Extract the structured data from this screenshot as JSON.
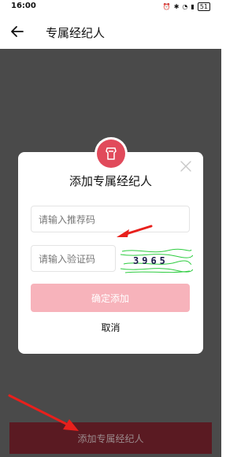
{
  "status_bar": {
    "time": "16:00",
    "battery": "51"
  },
  "header": {
    "title": "专属经纪人"
  },
  "modal": {
    "title": "添加专属经纪人",
    "referral_placeholder": "请输入推荐码",
    "code_placeholder": "请输入验证码",
    "captcha_text": "3965",
    "confirm_label": "确定添加",
    "cancel_label": "取消"
  },
  "bottom": {
    "add_button_label": "添加专属经纪人"
  },
  "colors": {
    "accent": "#e14a5b",
    "confirm_disabled": "#f7b3bb",
    "overlay": "#4a4a4a",
    "arrow": "#e8201c"
  }
}
